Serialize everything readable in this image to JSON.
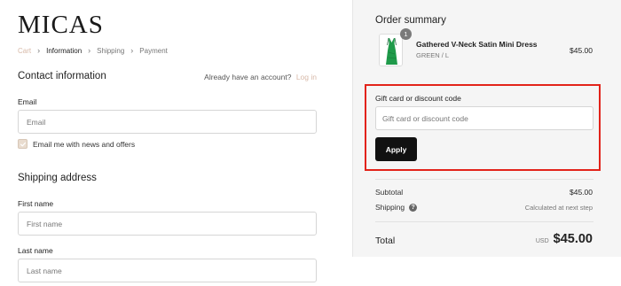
{
  "brand": {
    "logo_text": "MICAS"
  },
  "breadcrumb": [
    {
      "label": "Cart"
    },
    {
      "label": "Information"
    },
    {
      "label": "Shipping"
    },
    {
      "label": "Payment"
    }
  ],
  "contact": {
    "title": "Contact information",
    "account_prompt": "Already have an account?",
    "login_link": "Log in",
    "email_label": "Email",
    "email_placeholder": "Email",
    "email_value": "",
    "newsletter_label": "Email me with news and offers",
    "newsletter_checked": true
  },
  "shipping": {
    "title": "Shipping address",
    "first_name_label": "First name",
    "first_name_placeholder": "First name",
    "last_name_label": "Last name",
    "last_name_placeholder": "Last name"
  },
  "summary": {
    "title": "Order summary",
    "item": {
      "quantity": "1",
      "name": "Gathered V-Neck Satin Mini Dress",
      "variant": "GREEN / L",
      "price": "$45.00",
      "thumbnail_icon": "green-dress-image"
    },
    "discount": {
      "label": "Gift card or discount code",
      "placeholder": "Gift card or discount code",
      "apply_label": "Apply"
    },
    "subtotal_label": "Subtotal",
    "subtotal_value": "$45.00",
    "shipping_label": "Shipping",
    "shipping_value": "Calculated at next step",
    "total_label": "Total",
    "total_currency": "USD",
    "total_value": "$45.00"
  },
  "colors": {
    "accent": "#d7b9a8",
    "highlight": "#e2231a",
    "button": "#111111",
    "panel": "#f5f5f5",
    "dress": "#1f9a4a"
  }
}
